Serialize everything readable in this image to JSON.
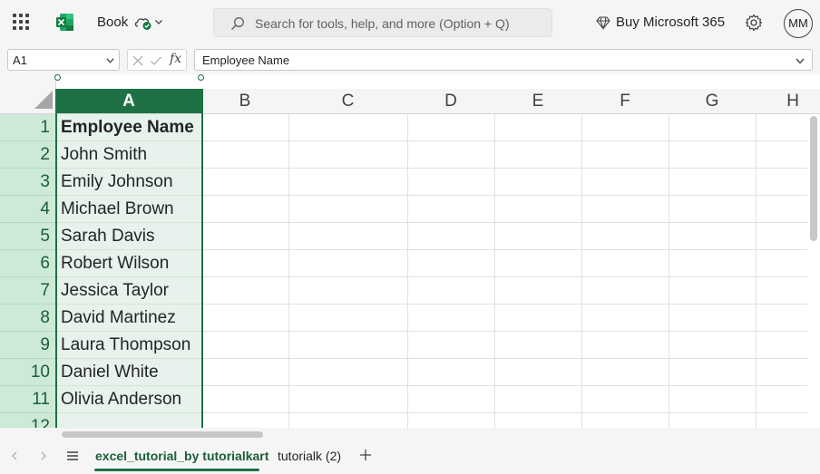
{
  "header": {
    "title": "Book",
    "search_placeholder": "Search for tools, help, and more (Option + Q)",
    "buy_label": "Buy Microsoft 365",
    "avatar_initials": "MM"
  },
  "formula_bar": {
    "name_box": "A1",
    "fx_label": "fx",
    "formula": "Employee Name"
  },
  "grid": {
    "columns": [
      "A",
      "B",
      "C",
      "D",
      "E",
      "F",
      "G",
      "H"
    ],
    "rows": [
      {
        "num": "1",
        "a": "Employee Name"
      },
      {
        "num": "2",
        "a": "John Smith"
      },
      {
        "num": "3",
        "a": "Emily Johnson"
      },
      {
        "num": "4",
        "a": "Michael Brown"
      },
      {
        "num": "5",
        "a": "Sarah Davis"
      },
      {
        "num": "6",
        "a": "Robert Wilson"
      },
      {
        "num": "7",
        "a": "Jessica Taylor"
      },
      {
        "num": "8",
        "a": "David Martinez"
      },
      {
        "num": "9",
        "a": "Laura Thompson"
      },
      {
        "num": "10",
        "a": "Daniel White"
      },
      {
        "num": "11",
        "a": "Olivia Anderson"
      },
      {
        "num": "12",
        "a": ""
      }
    ]
  },
  "sheets": {
    "tabs": [
      {
        "label": "excel_tutorial_by tutorialkart",
        "active": true
      },
      {
        "label": "tutorialk (2)",
        "active": false
      }
    ]
  },
  "colors": {
    "accent": "#1e7145",
    "selected_fill": "#e6f2eb",
    "row_header_fill": "#cde9d8"
  }
}
